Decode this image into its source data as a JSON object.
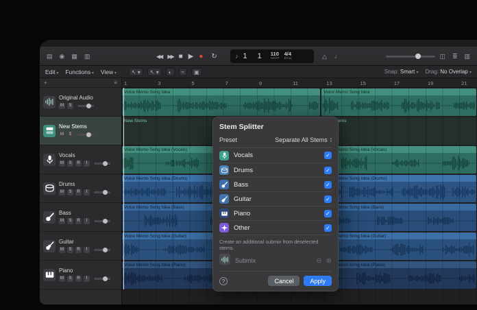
{
  "control_bar": {
    "left_icons": [
      {
        "name": "library-icon",
        "glyph": "▤"
      },
      {
        "name": "inspector-icon",
        "glyph": "◉"
      },
      {
        "name": "smart-controls-icon",
        "glyph": "▦"
      },
      {
        "name": "mixer-icon",
        "glyph": "▥"
      }
    ],
    "transport": {
      "rewind": "◀◀",
      "forward": "▶▶",
      "stop": "■",
      "play": "▶",
      "record": "●",
      "cycle": "↻"
    },
    "lcd": {
      "note": "♪",
      "position": "1 1",
      "tempo": "110",
      "tempo_sub": "KEEP",
      "timesig": "4/4",
      "timesig_sub": "Bmaj"
    },
    "mid_icons": [
      {
        "name": "metronome-icon",
        "glyph": "△"
      },
      {
        "name": "count-in-icon",
        "glyph": "♩"
      }
    ],
    "right_icons": [
      {
        "name": "display-mode-icon",
        "glyph": "◫"
      },
      {
        "name": "list-editors-icon",
        "glyph": "≣"
      },
      {
        "name": "browsers-icon",
        "glyph": "▥"
      }
    ]
  },
  "toolbar": {
    "menus": [
      "Edit",
      "Functions",
      "View"
    ],
    "tools": [
      {
        "name": "pointer-tool-selector",
        "glyph": "↖ ▾"
      },
      {
        "name": "command-tool-selector",
        "glyph": "↖ ▾"
      },
      {
        "name": "automation-icon",
        "glyph": "◐"
      },
      {
        "name": "flex-time-icon",
        "glyph": "≈"
      },
      {
        "name": "zoom-tool-icon",
        "glyph": "▣"
      }
    ],
    "snap_label": "Snap:",
    "snap_value": "Smart",
    "drag_label": "Drag:",
    "drag_value": "No Overlap",
    "chevron": "▾"
  },
  "tracklist_header": {
    "add_label": "+",
    "options_glyph": "≡"
  },
  "ruler": {
    "bars": [
      1,
      3,
      5,
      7,
      9,
      11,
      13,
      15,
      17,
      19,
      21
    ]
  },
  "tracks": [
    {
      "name": "Original Audio",
      "icon": "wave",
      "icon_color": "#3d3d41",
      "buttons": [
        "M",
        "S"
      ],
      "selected": false
    },
    {
      "name": "New Stems",
      "icon": "stack",
      "icon_color": "#3f8f7f",
      "buttons": [
        "M",
        "S"
      ],
      "selected": true
    },
    {
      "name": "Vocals",
      "icon": "mic",
      "icon_color": "#3d3d41",
      "buttons": [
        "M",
        "S",
        "R",
        "I"
      ],
      "selected": false
    },
    {
      "name": "Drums",
      "icon": "drum",
      "icon_color": "#3d3d41",
      "buttons": [
        "M",
        "S",
        "R",
        "I"
      ],
      "selected": false
    },
    {
      "name": "Bass",
      "icon": "bass",
      "icon_color": "#3d3d41",
      "buttons": [
        "M",
        "S",
        "R",
        "I"
      ],
      "selected": false
    },
    {
      "name": "Guitar",
      "icon": "guitar",
      "icon_color": "#3d3d41",
      "buttons": [
        "M",
        "S",
        "R",
        "I"
      ],
      "selected": false
    },
    {
      "name": "Piano",
      "icon": "piano",
      "icon_color": "#3d3d41",
      "buttons": [
        "M",
        "S",
        "R",
        "I"
      ],
      "selected": false
    }
  ],
  "regions": [
    {
      "label": "Voice Memo Song Idea",
      "type": "wave",
      "header": "#44907f",
      "body": "#2e6e62",
      "wave": "#16443c",
      "label_color": "#0c2d27",
      "gap": 0.15,
      "amp": 0.95
    },
    {
      "label": "New Stems",
      "type": "empty",
      "body": "#25302c",
      "label_color": "#7cc8b2"
    },
    {
      "label": "Voice Memo Song Idea (Vocals)",
      "type": "wave",
      "header": "#44907f",
      "body": "#2e6e62",
      "wave": "#16443c",
      "label_color": "#0c2d27",
      "gap": 0.45,
      "amp": 0.85
    },
    {
      "label": "Voice Memo Song Idea (Drums)",
      "type": "wave",
      "header": "#3e73ab",
      "body": "#2c5584",
      "wave": "#16365c",
      "label_color": "#0a1f38",
      "gap": 0.05,
      "amp": 0.95
    },
    {
      "label": "Voice Memo Song Idea (Bass)",
      "type": "wave",
      "header": "#3a6ba0",
      "body": "#284d78",
      "wave": "#143254",
      "label_color": "#0a1f38",
      "gap": 0.5,
      "amp": 0.8
    },
    {
      "label": "Voice Memo Song Idea (Guitar)",
      "type": "wave",
      "header": "#3c6fa5",
      "body": "#2a507c",
      "wave": "#153456",
      "label_color": "#0a1f38",
      "gap": 0.3,
      "amp": 0.85
    },
    {
      "label": "Voice Memo Song Idea (Piano)",
      "type": "wave",
      "header": "#33567f",
      "body": "#23395c",
      "wave": "#12233f",
      "label_color": "#0a1830",
      "gap": 0.25,
      "amp": 0.8
    }
  ],
  "dialog": {
    "title": "Stem Splitter",
    "preset_label": "Preset",
    "preset_value": "Separate All Stems",
    "stems": [
      {
        "label": "Vocals",
        "icon": "mic",
        "color": "#3fa08e",
        "checked": true
      },
      {
        "label": "Drums",
        "icon": "drum",
        "color": "#4a7fb5",
        "checked": true
      },
      {
        "label": "Bass",
        "icon": "bass",
        "color": "#3f6fae",
        "checked": true
      },
      {
        "label": "Guitar",
        "icon": "guitar",
        "color": "#4173b0",
        "checked": true
      },
      {
        "label": "Piano",
        "icon": "piano",
        "color": "#2e4a7a",
        "checked": true
      },
      {
        "label": "Other",
        "icon": "sparkle",
        "color": "#7b5bd6",
        "checked": true
      }
    ],
    "checkmark": "✓",
    "accent_color": "#2e7bf6",
    "submix_note": "Create an additional submix from deselected stems.",
    "submix_label": "Submix",
    "submix_minus": "⊖",
    "submix_plus": "⊕",
    "help_label": "?",
    "cancel_label": "Cancel",
    "apply_label": "Apply"
  }
}
